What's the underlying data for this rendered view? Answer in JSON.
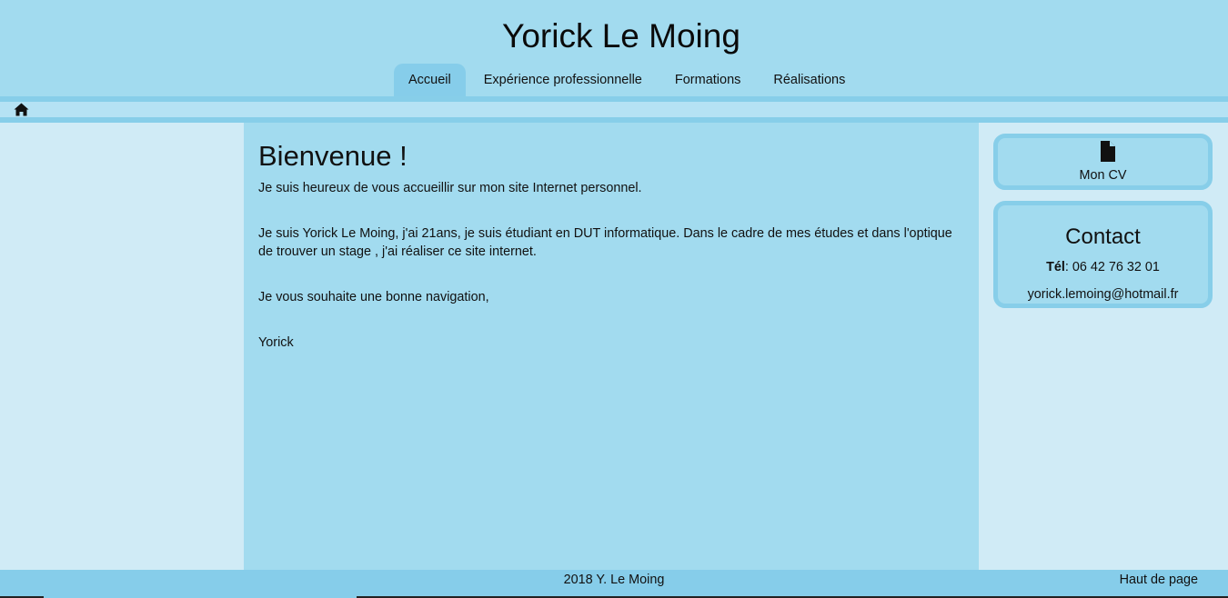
{
  "site": {
    "title": "Yorick Le Moing"
  },
  "nav": {
    "items": [
      {
        "label": "Accueil"
      },
      {
        "label": "Expérience professionnelle"
      },
      {
        "label": "Formations"
      },
      {
        "label": "Réalisations"
      }
    ],
    "active_index": 0
  },
  "breadcrumb": {
    "icon": "home-icon"
  },
  "main": {
    "heading": "Bienvenue !",
    "paragraphs": [
      "Je suis heureux de vous accueillir sur mon site Internet personnel.",
      "Je suis Yorick Le Moing, j'ai 21ans, je suis étudiant en DUT informatique. Dans le cadre de mes études et dans l'optique de trouver un stage , j'ai réaliser ce site internet.",
      "Je vous souhaite une bonne navigation,",
      "Yorick"
    ]
  },
  "sidebar": {
    "cv": {
      "icon": "file-icon",
      "label": "Mon CV"
    },
    "contact": {
      "title": "Contact",
      "tel_label": "Tél",
      "tel_value": ": 06 42 76 32 01",
      "email": "yorick.lemoing@hotmail.fr"
    }
  },
  "footer": {
    "copyright": "2018 Y. Le Moing",
    "top_link": "Haut de page"
  },
  "colors": {
    "header_bg": "#a2dbef",
    "accent": "#87cee9",
    "side_bg": "#d0ebf6",
    "breadbar_bg": "#b5e2f4"
  }
}
